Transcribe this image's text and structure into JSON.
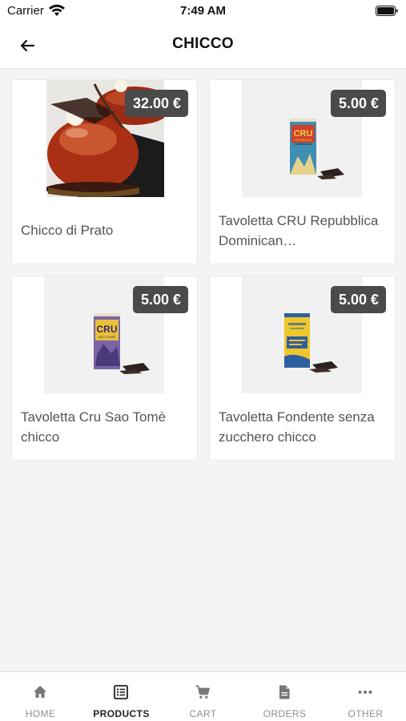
{
  "status_bar": {
    "carrier": "Carrier",
    "time": "7:49 AM"
  },
  "header": {
    "title": "CHICCO"
  },
  "products": [
    {
      "name": "Chicco di Prato",
      "price": "32.00 €"
    },
    {
      "name": "Tavoletta CRU Repubblica Dominican…",
      "price": "5.00 €",
      "package_text": [
        "CRU",
        "REPUBBLICA",
        "DOMINICANA"
      ]
    },
    {
      "name": "Tavoletta Cru Sao Tomè chicco",
      "price": "5.00 €",
      "package_text": [
        "CRU",
        "SAO TOMÈ"
      ]
    },
    {
      "name": "Tavoletta Fondente senza zucchero chicco",
      "price": "5.00 €"
    }
  ],
  "tabs": [
    {
      "label": "HOME",
      "icon": "home-icon",
      "active": false
    },
    {
      "label": "PRODUCTS",
      "icon": "list-icon",
      "active": true
    },
    {
      "label": "CART",
      "icon": "cart-icon",
      "active": false
    },
    {
      "label": "ORDERS",
      "icon": "document-icon",
      "active": false
    },
    {
      "label": "OTHER",
      "icon": "more-icon",
      "active": false
    }
  ],
  "colors": {
    "price_badge": "#4a4a4a",
    "background": "#f4f4f4",
    "active_tab": "#222222",
    "inactive_tab": "#8e8e8e"
  }
}
